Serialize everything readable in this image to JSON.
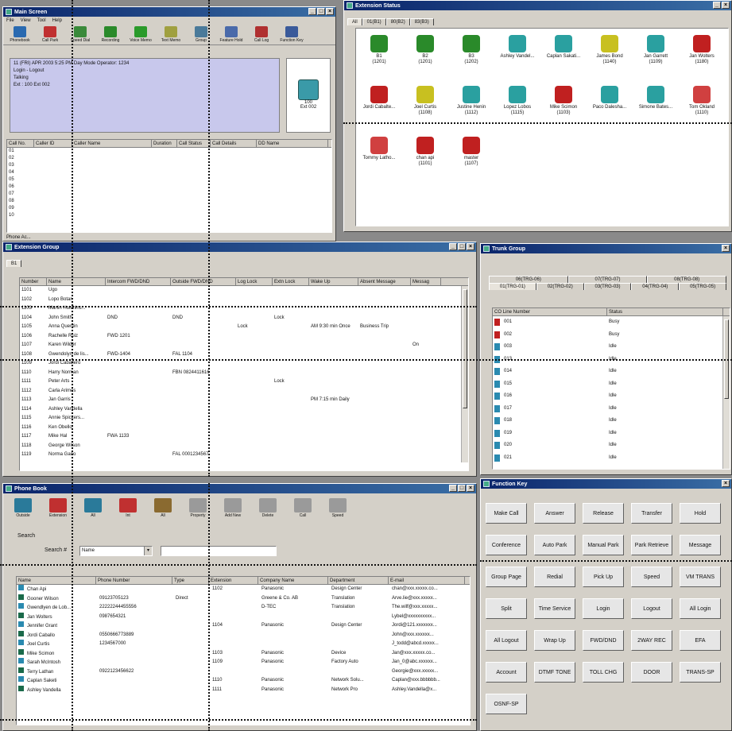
{
  "main_screen": {
    "title": "Main Screen",
    "menu": [
      "File",
      "View",
      "Tool",
      "Help"
    ],
    "toolbar": [
      "Phonebook",
      "Call Park",
      "Speed Dial",
      "Recording",
      "Voice Memo",
      "Text Memo",
      "Group",
      "Feature Hold",
      "Call Log",
      "Function Key"
    ],
    "status_lines": [
      "11 (FRI) APR 2003 5:25 PM Day Mode    Operator: 1234",
      "Login - Logout",
      "Talking",
      "Ext : 100 Ext 002"
    ],
    "phone_label": "100",
    "phone_sub": "Ext 002",
    "columns": [
      "Call No.",
      "Caller ID",
      "Caller Name",
      "Duration",
      "Call Status",
      "Call Details",
      "DD Name"
    ],
    "call_numbers": [
      "01",
      "02",
      "03",
      "04",
      "05",
      "06",
      "07",
      "08",
      "09",
      "10"
    ],
    "footer": "Phone Ac..."
  },
  "extension_status": {
    "title": "Extension Status",
    "tabs": [
      "All",
      "01(B1)",
      "80(B2)",
      "83(B3)"
    ],
    "phones": [
      {
        "name": "B1",
        "num": "(1201)",
        "color": "#2a8a2a"
      },
      {
        "name": "B2",
        "num": "(1201)",
        "color": "#2a8a2a"
      },
      {
        "name": "B3",
        "num": "(1202)",
        "color": "#2a8a2a"
      },
      {
        "name": "Ashley Vandel...",
        "num": "",
        "color": "#2aa0a0"
      },
      {
        "name": "Caplan Sakati...",
        "num": "",
        "color": "#2aa0a0"
      },
      {
        "name": "James Bond",
        "num": "(1140)",
        "color": "#c8c020"
      },
      {
        "name": "Jan Garrett",
        "num": "(1109)",
        "color": "#2aa0a0"
      },
      {
        "name": "Jan Wolters",
        "num": "(1180)",
        "color": "#c02020"
      },
      {
        "name": "Jordi Cabalte...",
        "num": "",
        "color": "#c02020"
      },
      {
        "name": "Joel Curtis",
        "num": "(1108)",
        "color": "#c8c020"
      },
      {
        "name": "Justine Henin",
        "num": "(1112)",
        "color": "#2aa0a0"
      },
      {
        "name": "Lopez Lobos",
        "num": "(1115)",
        "color": "#2aa0a0"
      },
      {
        "name": "Mike Scimon",
        "num": "(1103)",
        "color": "#c02020"
      },
      {
        "name": "Paco Dalesha...",
        "num": "",
        "color": "#2aa0a0"
      },
      {
        "name": "Simone Bates...",
        "num": "",
        "color": "#2aa0a0"
      },
      {
        "name": "Tom Okland",
        "num": "(1110)",
        "color": "#d04040"
      },
      {
        "name": "Tommy Latho...",
        "num": "",
        "color": "#d04040"
      },
      {
        "name": "chan api",
        "num": "(1101)",
        "color": "#c02020"
      },
      {
        "name": "master",
        "num": "(1107)",
        "color": "#c02020"
      }
    ]
  },
  "extension_group": {
    "title": "Extension Group",
    "tab": "B1",
    "columns": [
      "Number",
      "Name",
      "Intercom FWD/DND",
      "Outside FWD/DND",
      "Log Lock",
      "Extn Lock",
      "Wake Up",
      "Absent Message",
      "Messag"
    ],
    "rows": [
      [
        "1101",
        "Ugo",
        "",
        "",
        "",
        "",
        "",
        "",
        ""
      ],
      [
        "1102",
        "Lopo Botar",
        "",
        "",
        "",
        "",
        "",
        "",
        ""
      ],
      [
        "1103",
        "Martin Hutchins...",
        "",
        "",
        "",
        "",
        "",
        "",
        ""
      ],
      [
        "1104",
        "John Smith",
        "DND",
        "DND",
        "",
        "Lock",
        "",
        "",
        ""
      ],
      [
        "1105",
        "Anna Quentin",
        "",
        "",
        "Lock",
        "",
        "AM 9:30 min Once",
        "Business Trip",
        ""
      ],
      [
        "1106",
        "Rachelle Ruiz",
        "FWD 1201",
        "",
        "",
        "",
        "",
        "",
        ""
      ],
      [
        "1107",
        "Karen Wilder",
        "",
        "",
        "",
        "",
        "",
        "",
        "On"
      ],
      [
        "1108",
        "Gwendolyn de lis...",
        "FWD-1404",
        "FAL 1104",
        "",
        "",
        "",
        "",
        ""
      ],
      [
        "1109",
        "Jordi Caballero",
        "",
        "",
        "",
        "",
        "",
        "",
        ""
      ],
      [
        "1110",
        "Harry Norman",
        "",
        "FBN 0824411616",
        "",
        "",
        "",
        "",
        ""
      ],
      [
        "1111",
        "Peter Arts",
        "",
        "",
        "",
        "Lock",
        "",
        "",
        ""
      ],
      [
        "1112",
        "Carla Arimos",
        "",
        "",
        "",
        "",
        "",
        "",
        ""
      ],
      [
        "1113",
        "Jan Garris",
        "",
        "",
        "",
        "",
        "PM 7:15 min Daily",
        "",
        ""
      ],
      [
        "1114",
        "Ashley Vandella",
        "",
        "",
        "",
        "",
        "",
        "",
        ""
      ],
      [
        "1115",
        "Annie Spickers...",
        "",
        "",
        "",
        "",
        "",
        "",
        ""
      ],
      [
        "1116",
        "Ken Obello",
        "",
        "",
        "",
        "",
        "",
        "",
        ""
      ],
      [
        "1117",
        "Mike Hal",
        "FWA 1133",
        "",
        "",
        "",
        "",
        "",
        ""
      ],
      [
        "1118",
        "George Wilson",
        "",
        "",
        "",
        "",
        "",
        "",
        ""
      ],
      [
        "1119",
        "Norma Gano",
        "",
        "FAL 0001234567",
        "",
        "",
        "",
        "",
        ""
      ]
    ]
  },
  "trunk_group": {
    "title": "Trunk Group",
    "tabs_row1": [
      "06(TRG-06)",
      "07(TRG-07)",
      "08(TRG-08)"
    ],
    "tabs_row2": [
      "01(TRG-01)",
      "02(TRG-02)",
      "03(TRG-03)",
      "04(TRG-04)",
      "05(TRG-05)"
    ],
    "columns": [
      "CO Line Number",
      "Status"
    ],
    "rows": [
      [
        "001",
        "Busy",
        "busy"
      ],
      [
        "002",
        "Busy",
        "busy"
      ],
      [
        "003",
        "Idle",
        "idle"
      ],
      [
        "013",
        "Idle",
        "idle"
      ],
      [
        "014",
        "Idle",
        "idle"
      ],
      [
        "015",
        "Idle",
        "idle"
      ],
      [
        "016",
        "Idle",
        "idle"
      ],
      [
        "017",
        "Idle",
        "idle"
      ],
      [
        "018",
        "Idle",
        "idle"
      ],
      [
        "019",
        "Idle",
        "idle"
      ],
      [
        "020",
        "Idle",
        "idle"
      ],
      [
        "021",
        "Idle",
        "idle"
      ]
    ]
  },
  "phone_book": {
    "title": "Phone Book",
    "toolbar": [
      "Outside",
      "Extension",
      "All",
      "Int",
      "All",
      "Property",
      "Add New",
      "Delete",
      "Call",
      "Speed"
    ],
    "search_label": "Search",
    "search_by_label": "Search #",
    "search_by_value": "Name",
    "columns": [
      "Name",
      "Phone Number",
      "Type",
      "Extension",
      "Company Name",
      "Department",
      "E-mail"
    ],
    "rows": [
      [
        "Chan Api",
        "",
        "",
        "1102",
        "Panasonic",
        "Design Center",
        "chan@xxx.xxxxx.co..."
      ],
      [
        "Gooner Wilson",
        "09123705123",
        "Direct",
        "",
        "Greene & Co. AB",
        "Translation",
        "Arve.lie@xxx.xxxxx..."
      ],
      [
        "Gwendlyen de Lob...",
        "22222244455556",
        "",
        "",
        "D-TEC",
        "Translation",
        "The.wilf@xxx.xxxxx..."
      ],
      [
        "Jan Wolters",
        "0987654321",
        "",
        "",
        "",
        "",
        "Lybel@xxxxxxxxxx..."
      ],
      [
        "Jennifer Grant",
        "",
        "",
        "1104",
        "Panasonic",
        "Design Center",
        "Jordi@121.xxxxxxx..."
      ],
      [
        "Jordi Caballo",
        "0550666773889",
        "",
        "",
        "",
        "",
        "John@xxx.xxxxxx..."
      ],
      [
        "Joel Curtis",
        "1234567000",
        "",
        "",
        "",
        "",
        "J_todd@abcd.xxxxx..."
      ],
      [
        "Mike Scimon",
        "",
        "",
        "1103",
        "Panasonic",
        "Device",
        "Jan@xxx.xxxxx.co..."
      ],
      [
        "Sarah McIntosh",
        "",
        "",
        "1109",
        "Panasonic",
        "Factory Auto",
        "Jan_0@abc.xxxxxx..."
      ],
      [
        "Terry Lathan",
        "0922123456622",
        "",
        "",
        "",
        "",
        "Georgie@xxx.xxxxx..."
      ],
      [
        "Caplan Saketi",
        "",
        "",
        "1110",
        "Panasonic",
        "Network Solu...",
        "Caplan@xxx.bbbbbb..."
      ],
      [
        "Ashley Vandella",
        "",
        "",
        "1111",
        "Panasonic",
        "Network Pro",
        "Ashley.Vandella@x..."
      ]
    ]
  },
  "function_key": {
    "title": "Function Key",
    "keys": [
      "Make Call",
      "Answer",
      "Release",
      "Transfer",
      "Hold",
      "Conference",
      "Auto Park",
      "Manual Park",
      "Park Retrieve",
      "Message",
      "Group Page",
      "Redial",
      "Pick Up",
      "Speed",
      "VM TRANS",
      "Split",
      "Time Service",
      "Login",
      "Logout",
      "All Login",
      "All Logout",
      "Wrap Up",
      "FWD/DND",
      "2WAY REC",
      "EFA",
      "Account",
      "DTMF TONE",
      "TOLL CHG",
      "DOOR",
      "TRANS-SP",
      "OSNF-SP"
    ]
  }
}
